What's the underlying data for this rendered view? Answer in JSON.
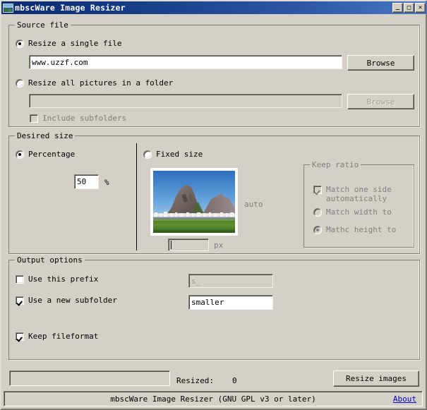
{
  "window": {
    "title": "mbscWare Image Resizer",
    "icon": "image-icon",
    "buttons": {
      "minimize": "_",
      "maximize": "□",
      "close": "✕"
    }
  },
  "source_file": {
    "legend": "Source file",
    "single_file": {
      "label": "Resize a single file",
      "checked": true,
      "value": "www.uzzf.com",
      "browse_label": "Browse"
    },
    "folder": {
      "label": "Resize all pictures in a folder",
      "checked": false,
      "value": "",
      "browse_label": "Browse",
      "include_subfolders_label": "Include subfolders",
      "include_subfolders_checked": false
    }
  },
  "desired_size": {
    "legend": "Desired size",
    "percentage": {
      "label": "Percentage",
      "checked": true,
      "value": "50",
      "unit": "%"
    },
    "fixed_size": {
      "label": "Fixed size",
      "checked": false,
      "width_value": "",
      "px_unit": "px",
      "auto_label": "auto",
      "preview_alt": "Sugarloaf Mountain preview thumbnail"
    },
    "keep_ratio": {
      "legend": "Keep ratio",
      "match_one_side": {
        "label": "Match one side automatically",
        "line1": "Match one side",
        "line2": "automatically",
        "checked": true
      },
      "match_width": {
        "label": "Match width to",
        "checked": false
      },
      "match_height": {
        "label": "Mathc height to",
        "checked": true
      }
    }
  },
  "output_options": {
    "legend": "Output options",
    "use_prefix": {
      "label": "Use this prefix",
      "checked": false,
      "value": "s_"
    },
    "use_subfolder": {
      "label": "Use a new subfolder",
      "checked": true,
      "value": "smaller"
    },
    "keep_fileformat": {
      "label": "Keep fileformat",
      "checked": true
    }
  },
  "footer": {
    "progress_percent": 0,
    "resized_label": "Resized:",
    "resized_count": "0",
    "resize_button": "Resize images",
    "status_text": "mbscWare Image Resizer (GNU GPL v3 or later)",
    "about_label": "About"
  },
  "colors": {
    "window_face": "#d4d0c8",
    "titlebar_start": "#0b2a73",
    "titlebar_end": "#4a77c4",
    "link": "#0000cc",
    "disabled_text": "#808080"
  }
}
